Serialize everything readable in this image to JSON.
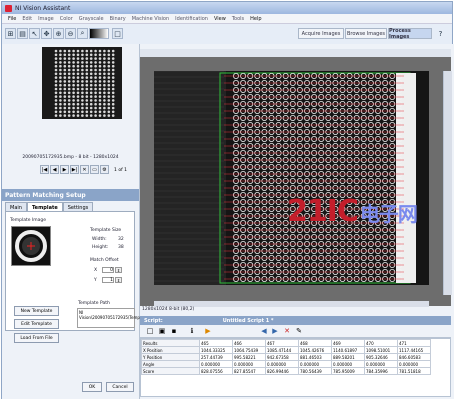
{
  "window": {
    "title": "NI Vision Assistant"
  },
  "menu": [
    "File",
    "Edit",
    "Image",
    "Color",
    "Grayscale",
    "Binary",
    "Machine Vision",
    "Identification",
    "View",
    "Tools",
    "Help"
  ],
  "modes": [
    "Acquire Images",
    "Browse Images",
    "Process Images"
  ],
  "selected_mode": "Process Images",
  "browser": {
    "filename_info": "20090705172935.bmp - 8 bit - 1280x1024",
    "page": "1",
    "page_total": "of 1"
  },
  "setup": {
    "title": "Pattern Matching Setup",
    "tabs": [
      "Main",
      "Template",
      "Settings"
    ],
    "selected_tab": "Template",
    "template_image_label": "Template Image",
    "template_size_label": "Template Size",
    "width_label": "Width:",
    "width_value": "32",
    "height_label": "Height:",
    "height_value": "38",
    "match_offset_label": "Match Offset",
    "x_label": "X",
    "x_value": "0",
    "y_label": "Y",
    "y_value": "1",
    "template_path_label": "Template Path",
    "template_path_value": "NI Vision\\20090705172935\\Template.png",
    "new_template": "New Template",
    "edit_template": "Edit Template",
    "load_from_file": "Load From File",
    "ok": "OK",
    "cancel": "Cancel"
  },
  "viewer": {
    "status": "1280x1024 8-bit  (80,2)",
    "watermark": "21IC",
    "watermark_cn": "电子网"
  },
  "script": {
    "label": "Script:",
    "title": "Untitled Script 1 *"
  },
  "results": {
    "header_label": "Results",
    "columns": [
      "465",
      "466",
      "467",
      "468",
      "469",
      "470",
      "471"
    ],
    "rows": [
      {
        "label": "X Position",
        "values": [
          "1044.33325",
          "1064.75439",
          "1085.47144",
          "1045.42676",
          "1140.61897",
          "1098.51001",
          "1117.44165"
        ]
      },
      {
        "label": "Y Position",
        "values": [
          "257.44739",
          "995.58221",
          "942.67358",
          "881.46503",
          "889.58201",
          "905.32646",
          "846.60583"
        ]
      },
      {
        "label": "Angle",
        "values": [
          "0.000000",
          "0.000000",
          "0.000000",
          "0.000000",
          "0.000000",
          "0.000000",
          "0.000000"
        ]
      },
      {
        "label": "Score",
        "values": [
          "828.07556",
          "827.85547",
          "826.99446",
          "780.56439",
          "785.95009",
          "784.35996",
          "781.51818"
        ]
      }
    ]
  }
}
